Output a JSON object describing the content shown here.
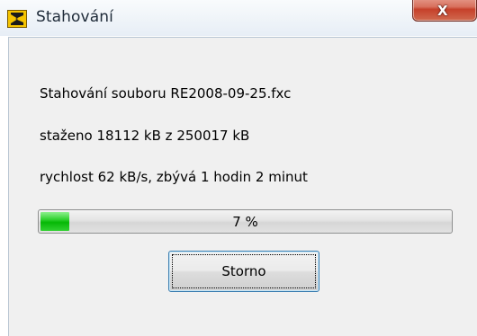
{
  "window": {
    "title": "Stahování",
    "close_label": "X",
    "app_icon": "sigma-download-icon"
  },
  "dialog": {
    "line_1": "Stahování souboru RE2008-09-25.fxc",
    "line_2": "staženo 18112 kB z 250017 kB",
    "line_3": "rychlost 62 kB/s, zbývá 1 hodin 2 minut"
  },
  "progress": {
    "percent": 7,
    "label": "7 %",
    "fill_color": "#06b806"
  },
  "buttons": {
    "cancel_label": "Storno"
  }
}
